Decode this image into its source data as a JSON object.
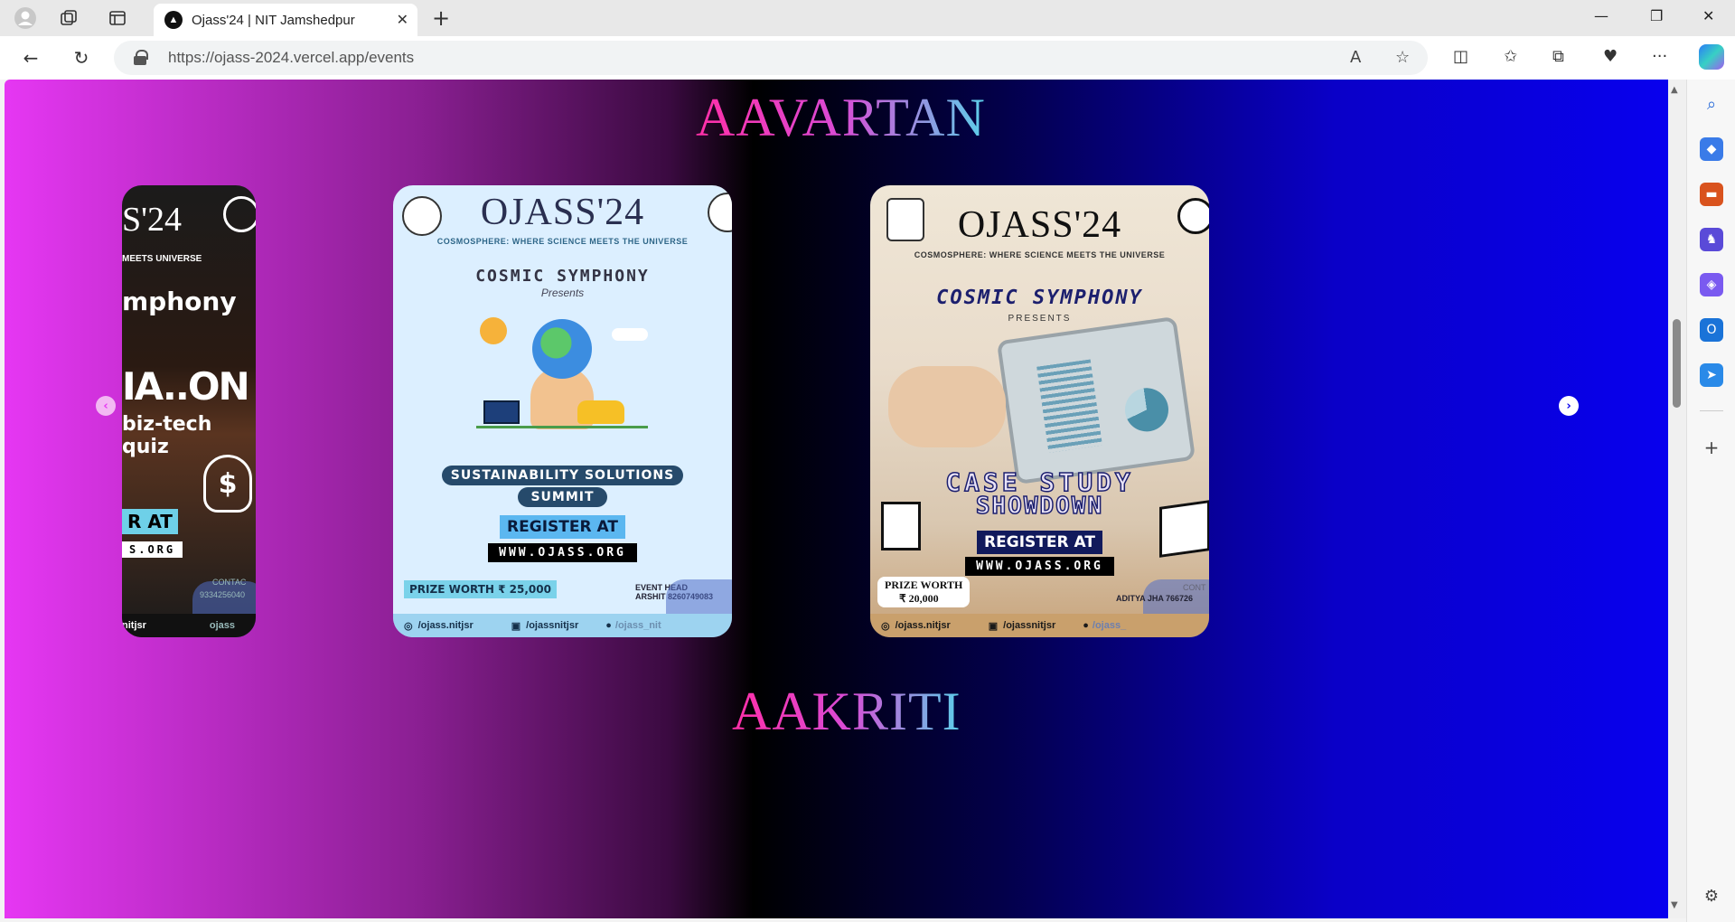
{
  "browser": {
    "tab_title": "Ojass'24 | NIT Jamshedpur",
    "tab_favicon": "▲",
    "url": "https://ojass-2024.vercel.app/events",
    "win_min": "—",
    "win_restore": "❐",
    "win_close": "✕",
    "new_tab": "+"
  },
  "sections": {
    "aavartan": "AAVARTAN",
    "aakriti": "AAKRITI"
  },
  "carousel": {
    "prev_icon": "‹",
    "next_icon": "›"
  },
  "cards": {
    "left": {
      "brand": "S'24",
      "tag": "MEETS UNIVERSE",
      "sub": "mphony",
      "big": "IA..ON",
      "quiz": "biz-tech quiz",
      "register": "R AT",
      "www": "S.ORG",
      "footer": "nitjsr",
      "footer2": "ojass",
      "contact": "CONTAC",
      "phone": "9334256040"
    },
    "middle": {
      "brand": "OJASS'24",
      "tag": "COSMOSPHERE: WHERE SCIENCE MEETS THE UNIVERSE",
      "event_series": "COSMIC SYMPHONY",
      "presents": "Presents",
      "title_line1": "SUSTAINABILITY SOLUTIONS",
      "title_line2": "SUMMIT",
      "register": "REGISTER AT",
      "www": "WWW.OJASS.ORG",
      "prize": "PRIZE WORTH ₹ 25,000",
      "event_head_label": "EVENT HEAD",
      "event_head": "ARSHIT   8260749083",
      "footer_ig": "/ojass.nitjsr",
      "footer_li": "/ojassnitjsr",
      "footer_yt": "/ojass_nit"
    },
    "right": {
      "brand": "OJASS'24",
      "tag": "COSMOSPHERE: WHERE SCIENCE MEETS THE UNIVERSE",
      "event_series": "COSMIC SYMPHONY",
      "presents": "PRESENTS",
      "title_line1": "CASE STUDY",
      "title_line2": "SHOWDOWN",
      "register": "REGISTER AT",
      "www": "WWW.OJASS.ORG",
      "prize_label": "PRIZE WORTH",
      "prize": "₹ 20,000",
      "contact": "ADITYA JHA  766726",
      "contact_label": "CONT",
      "footer_ig": "/ojass.nitjsr",
      "footer_li": "/ojassnitjsr",
      "footer_yt": "/ojass_"
    }
  },
  "colors": {
    "gradient_left": "#e637f3",
    "gradient_mid": "#000000",
    "gradient_right": "#0800ee",
    "title_pink": "#ff2fa8",
    "title_cyan": "#5bd0ea"
  }
}
